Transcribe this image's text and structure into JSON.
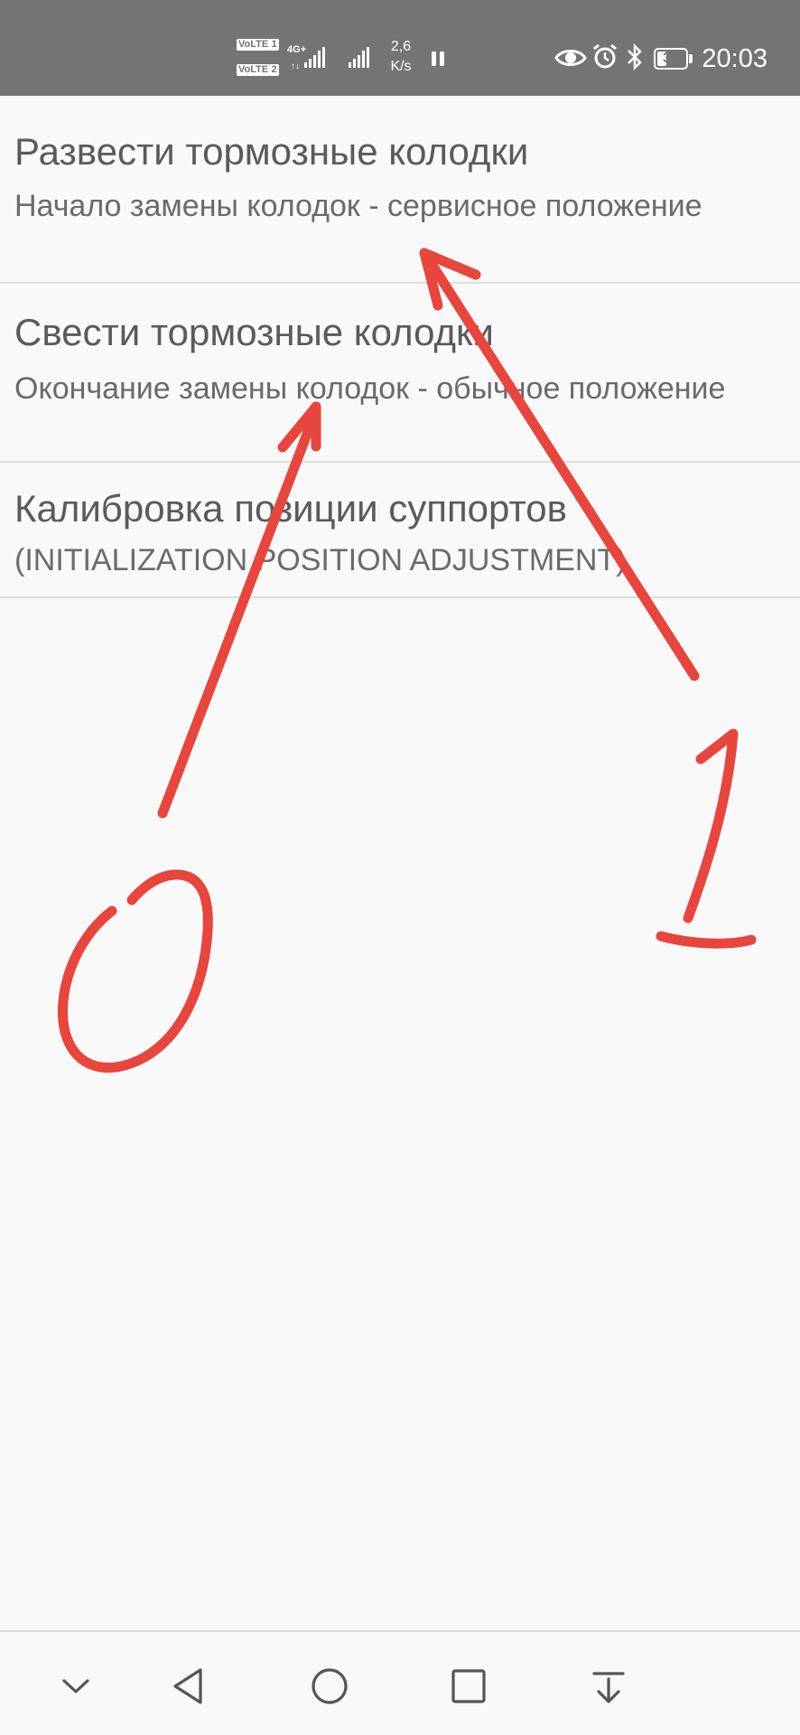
{
  "status_bar": {
    "sim1_label": "VoLTE",
    "sim1_number": "1",
    "sim2_label": "VoLTE",
    "sim2_number": "2",
    "network_type": "4G+",
    "data_speed_value": "2,6",
    "data_speed_unit": "K/s",
    "battery_level": "32",
    "time": "20:03",
    "icons": [
      "volte-icon",
      "signal-icon",
      "signal-icon",
      "pause-icon",
      "eye-comfort-icon",
      "alarm-icon",
      "bluetooth-icon",
      "battery-icon"
    ]
  },
  "settings": {
    "items": [
      {
        "title": "Развести тормозные колодки",
        "subtitle": "Начало замены колодок - сервисное положение"
      },
      {
        "title": "Свести тормозные колодки",
        "subtitle": "Окончание замены колодок - обычное положение"
      },
      {
        "title": "Калибровка позиции суппортов",
        "subtitle": "(INITIALIZATION POSITION ADJUSTMENT)"
      }
    ]
  },
  "annotations": {
    "color": "#e8453c",
    "labels": [
      {
        "text": "0",
        "points_to_item": 2
      },
      {
        "text": "1",
        "points_to_item": 1
      }
    ]
  },
  "nav_bar": {
    "icons": [
      "chevron-down-icon",
      "back-icon",
      "home-icon",
      "recents-icon",
      "notification-pull-icon"
    ]
  },
  "colors": {
    "status_bar_bg": "#747474",
    "background": "#f9f9fa",
    "title_text": "#5a5a5a",
    "subtitle_text": "#6a6a6a",
    "divider": "#dcdcdc",
    "annotation": "#e8453c"
  }
}
